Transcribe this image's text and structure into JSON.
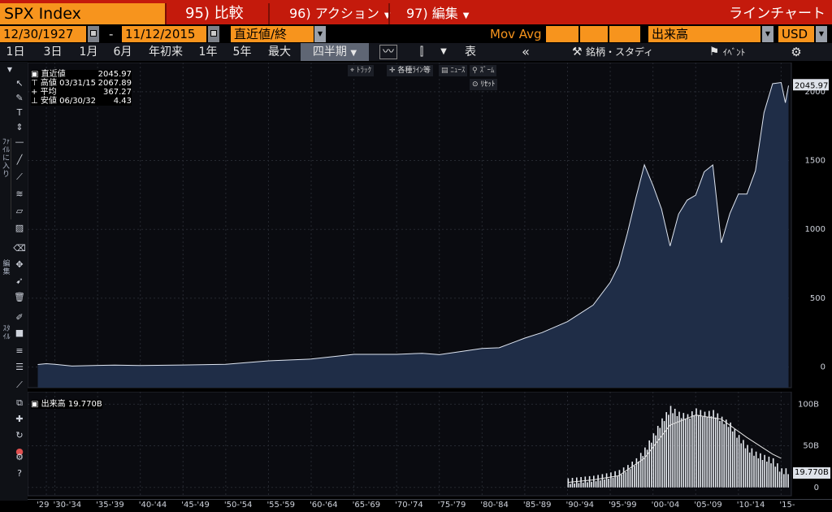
{
  "titlebar": {
    "ticker": "SPX Index",
    "menu_compare": "95) 比較",
    "menu_action": "96) アクション",
    "menu_edit": "97) 編集",
    "chart_type": "ラインチャート"
  },
  "controls": {
    "start_date": "12/30/1927",
    "dash": "-",
    "end_date": "11/12/2015",
    "price_field": "直近値/終",
    "mov_avg_label": "Mov Avg",
    "volume_field": "出来高",
    "currency": "USD"
  },
  "periods": [
    "1日",
    "3日",
    "1月",
    "6月",
    "年初来",
    "1年",
    "5年",
    "最大"
  ],
  "frequency": "四半期",
  "toolbar": {
    "table_label": "表",
    "security_study": "銘柄・スタディ",
    "event_label": "ｲﾍﾞﾝﾄ"
  },
  "annotation_buttons": {
    "track": "ﾄﾗｯｸ",
    "cross": "各種ﾗｲﾝ等",
    "news": "ﾆｭｰｽ",
    "zoom": "ｽﾞｰﾑ",
    "reset": "ﾘｾｯﾄ"
  },
  "legend": {
    "last_label": "直近値",
    "last_value": "2045.97",
    "high_label": "高値",
    "high_date": "03/31/15",
    "high_value": "2067.89",
    "avg_label": "平均",
    "avg_value": "367.27",
    "low_label": "安値",
    "low_date": "06/30/32",
    "low_value": "4.43"
  },
  "volume_legend": {
    "label": "出来高",
    "value": "19.770B"
  },
  "volume_current_tag": "19.770B",
  "left_toolbar_labels": {
    "favorites": "ﾌｧｲﾙに入り",
    "edit": "編集",
    "style": "ｽﾀｲﾙ"
  },
  "colors": {
    "accent_orange": "#f7941d",
    "title_red": "#c41a0c",
    "area_fill": "#1f2d47",
    "line": "#dfe6f2",
    "volume_bar": "#e8ecf2"
  },
  "chart_data": [
    {
      "type": "area",
      "series": [
        {
          "name": "直近値",
          "x": [
            1928,
            1929,
            1930,
            1932,
            1935,
            1937,
            1940,
            1945,
            1950,
            1955,
            1960,
            1965,
            1970,
            1973,
            1975,
            1980,
            1982,
            1985,
            1987,
            1990,
            1993,
            1995,
            1996,
            1997,
            1998,
            1999,
            2000,
            2001,
            2002,
            2003,
            2004,
            2005,
            2006,
            2007,
            2008,
            2009,
            2010,
            2011,
            2012,
            2013,
            2014,
            2015,
            2015.5,
            2015.87
          ],
          "values": [
            18,
            24,
            20,
            7,
            12,
            14,
            11,
            15,
            20,
            45,
            58,
            92,
            92,
            100,
            90,
            135,
            140,
            210,
            250,
            330,
            450,
            615,
            740,
            970,
            1229,
            1469,
            1320,
            1148,
            879,
            1111,
            1212,
            1248,
            1418,
            1468,
            903,
            1115,
            1257,
            1257,
            1426,
            1848,
            2058,
            2067,
            1920,
            2045
          ]
        }
      ],
      "xlabel": "",
      "ylabel": "",
      "ylim": [
        -150,
        2200
      ],
      "yticks": [
        "2000",
        "1500",
        "1000",
        "500",
        "0"
      ],
      "yvals": [
        2000,
        1500,
        1000,
        500,
        0
      ],
      "xticks": [
        "'29",
        "'30-'34",
        "'35-'39",
        "'40-'44",
        "'45-'49",
        "'50-'54",
        "'55-'59",
        "'60-'64",
        "'65-'69",
        "'70-'74",
        "'75-'79",
        "'80-'84",
        "'85-'89",
        "'90-'94",
        "'95-'99",
        "'00-'04",
        "'05-'09",
        "'10-'14",
        "'15-"
      ],
      "grid": true
    },
    {
      "type": "bar",
      "series": [
        {
          "name": "出来高",
          "x": [
            1990,
            1991,
            1992,
            1993,
            1994,
            1995,
            1996,
            1997,
            1998,
            1999,
            2000,
            2001,
            2002,
            2003,
            2004,
            2005,
            2006,
            2007,
            2008,
            2009,
            2010,
            2011,
            2012,
            2013,
            2014,
            2015
          ],
          "values": [
            8,
            9,
            10,
            11,
            13,
            15,
            18,
            24,
            32,
            45,
            62,
            80,
            95,
            88,
            85,
            92,
            88,
            90,
            82,
            75,
            60,
            48,
            40,
            36,
            32,
            20
          ]
        },
        {
          "name": "移動平均",
          "x": [
            1990,
            1993,
            1996,
            1999,
            2002,
            2005,
            2008,
            2011,
            2014,
            2015
          ],
          "values": [
            6,
            9,
            14,
            35,
            75,
            87,
            82,
            60,
            40,
            35
          ]
        }
      ],
      "ylim": [
        -10,
        115
      ],
      "yticks": [
        "100B",
        "50B",
        "0"
      ],
      "yvals": [
        100,
        50,
        0
      ]
    }
  ]
}
